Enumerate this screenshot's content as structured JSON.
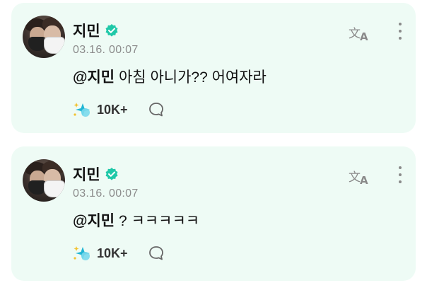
{
  "posts": [
    {
      "author": "지민",
      "timestamp": "03.16. 00:07",
      "mention": "@지민",
      "message": "아침 아니가?? 어여자라",
      "reaction_count": "10K+"
    },
    {
      "author": "지민",
      "timestamp": "03.16. 00:07",
      "mention": "@지민",
      "message": "? ㅋㅋㅋㅋㅋ",
      "reaction_count": "10K+"
    }
  ],
  "icons": {
    "verified": "verified-badge-icon",
    "translate": "translate-icon",
    "more": "more-vertical-icon",
    "reaction": "sparkle-reaction-icon",
    "comment": "comment-bubble-icon"
  },
  "colors": {
    "card_background": "#eefbf5",
    "verified": "#1fc8a8",
    "reaction_primary": "#1fb5d4",
    "reaction_accent": "#f2c230"
  }
}
